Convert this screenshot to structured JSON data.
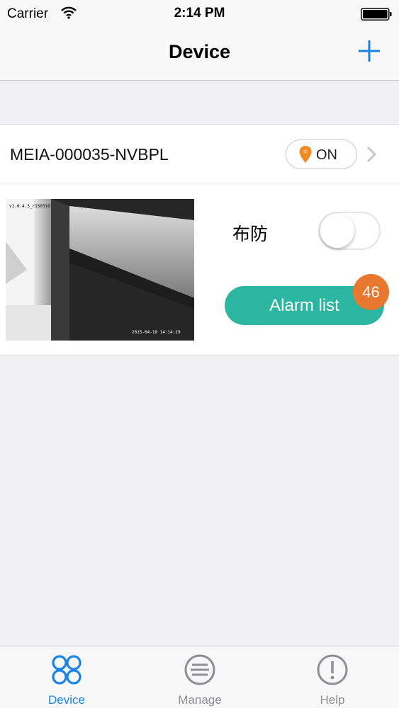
{
  "status_bar": {
    "carrier": "Carrier",
    "time": "2:14 PM"
  },
  "nav": {
    "title": "Device",
    "add_icon": "plus-icon"
  },
  "device": {
    "name": "MEIA-000035-NVBPL",
    "status": "ON",
    "status_icon": "location-pin-icon",
    "thumbnail": {
      "overlay_top": "v1.0.4.3_r150310",
      "overlay_bottom": "2015-04-10 14:14:19"
    },
    "arm_label": "布防",
    "arm_enabled": false,
    "alarm_button_label": "Alarm list",
    "alarm_count": "46"
  },
  "tabs": [
    {
      "label": "Device",
      "icon": "four-circles-icon",
      "active": true
    },
    {
      "label": "Manage",
      "icon": "list-circle-icon",
      "active": false
    },
    {
      "label": "Help",
      "icon": "exclamation-circle-icon",
      "active": false
    }
  ],
  "colors": {
    "accent": "#1a83e8",
    "teal": "#2cb5a0",
    "badge": "#e8772f",
    "background": "#efeff4"
  }
}
